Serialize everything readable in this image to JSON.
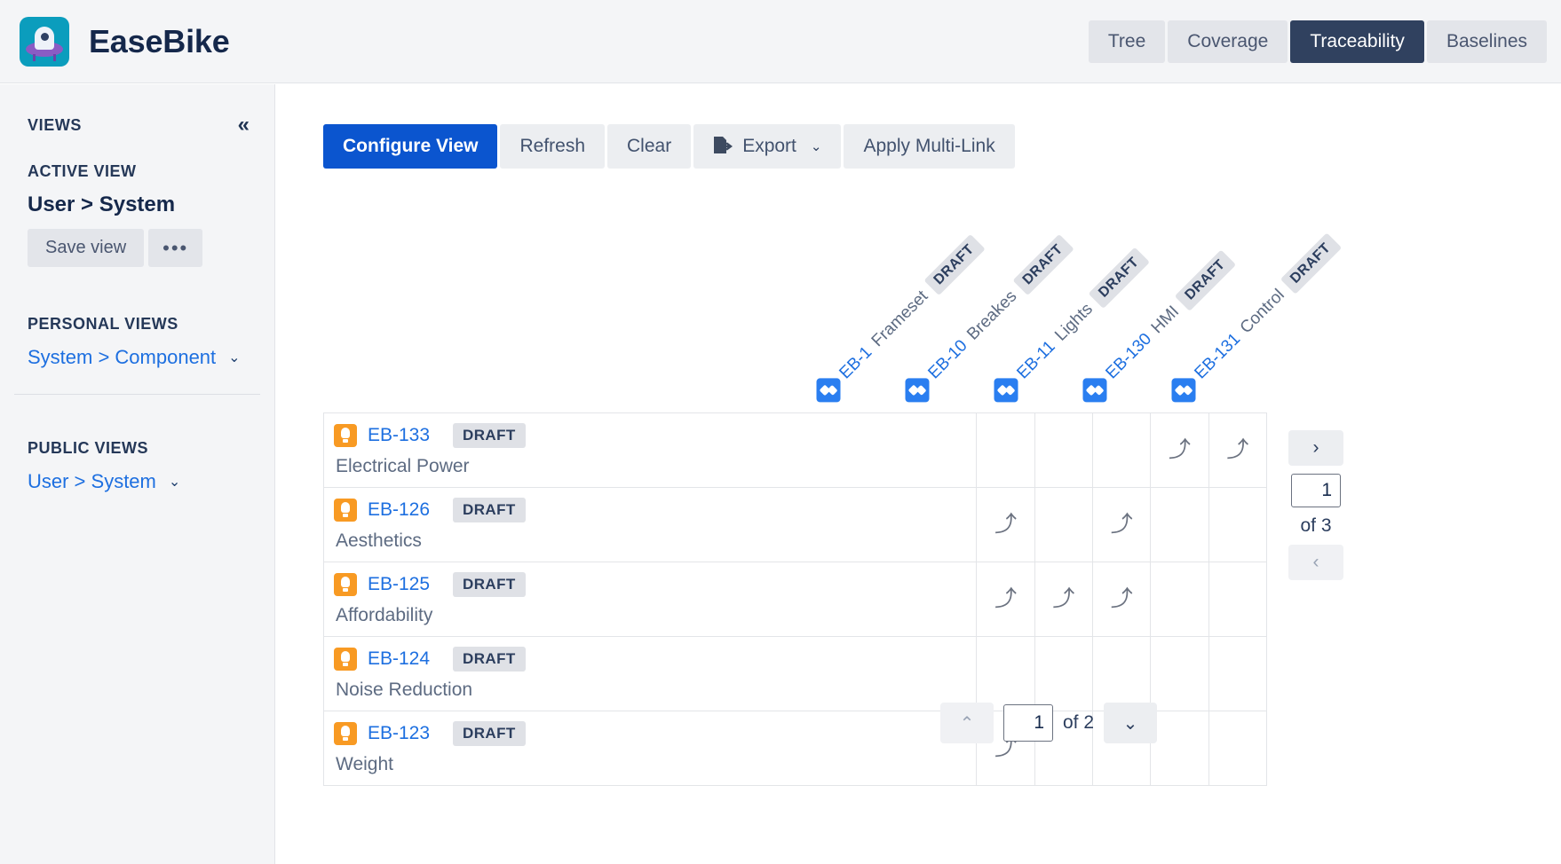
{
  "header": {
    "app_name": "EaseBike",
    "logo_icon": "easebike-alien-logo",
    "tabs": [
      {
        "label": "Tree",
        "active": false
      },
      {
        "label": "Coverage",
        "active": false
      },
      {
        "label": "Traceability",
        "active": true
      },
      {
        "label": "Baselines",
        "active": false
      }
    ]
  },
  "sidebar": {
    "title": "VIEWS",
    "collapse_icon": "«",
    "active_view_label": "ACTIVE VIEW",
    "active_view_name": "User > System",
    "save_view_label": "Save view",
    "more_label": "•••",
    "personal_views_label": "PERSONAL VIEWS",
    "personal_views": [
      {
        "label": "System > Component",
        "chevron": "⌄"
      }
    ],
    "public_views_label": "PUBLIC VIEWS",
    "public_views": [
      {
        "label": "User > System",
        "chevron": "⌄"
      }
    ]
  },
  "toolbar": {
    "configure_view": "Configure View",
    "refresh": "Refresh",
    "clear": "Clear",
    "export": "Export",
    "export_icon": "export-file-icon",
    "export_caret": "⌄",
    "apply_multi_link": "Apply Multi-Link"
  },
  "matrix": {
    "link_arrow_glyph": "⤴",
    "columns": [
      {
        "key": "EB-1",
        "summary": "Frameset",
        "status": "DRAFT",
        "icon": "jira-epic-diamond-icon"
      },
      {
        "key": "EB-10",
        "summary": "Breakes",
        "status": "DRAFT",
        "icon": "jira-epic-diamond-icon"
      },
      {
        "key": "EB-11",
        "summary": "Lights",
        "status": "DRAFT",
        "icon": "jira-epic-diamond-icon"
      },
      {
        "key": "EB-130",
        "summary": "HMI",
        "status": "DRAFT",
        "icon": "jira-epic-diamond-icon"
      },
      {
        "key": "EB-131",
        "summary": "Control",
        "status": "DRAFT",
        "icon": "jira-epic-diamond-icon"
      }
    ],
    "rows": [
      {
        "key": "EB-133",
        "status": "DRAFT",
        "summary": "Electrical Power",
        "icon": "lightbulb-icon",
        "links": [
          false,
          false,
          false,
          true,
          true
        ]
      },
      {
        "key": "EB-126",
        "status": "DRAFT",
        "summary": "Aesthetics",
        "icon": "lightbulb-icon",
        "links": [
          true,
          false,
          true,
          false,
          false
        ]
      },
      {
        "key": "EB-125",
        "status": "DRAFT",
        "summary": "Affordability",
        "icon": "lightbulb-icon",
        "links": [
          true,
          true,
          true,
          false,
          false
        ]
      },
      {
        "key": "EB-124",
        "status": "DRAFT",
        "summary": "Noise Reduction",
        "icon": "lightbulb-icon",
        "links": [
          false,
          false,
          false,
          false,
          false
        ]
      },
      {
        "key": "EB-123",
        "status": "DRAFT",
        "summary": "Weight",
        "icon": "lightbulb-icon",
        "links": [
          true,
          false,
          false,
          false,
          false
        ]
      }
    ]
  },
  "column_pager": {
    "next_icon": "›",
    "prev_icon": "‹",
    "page_value": "1",
    "of_label": "of 3"
  },
  "row_pager": {
    "up_icon": "⌃",
    "down_icon": "⌄",
    "page_value": "1",
    "of_label": "of 2"
  },
  "colors": {
    "primary": "#0b55cf",
    "tab_active_bg": "#30415f",
    "link": "#1d6fe0",
    "status_badge_bg": "#dfe1e6",
    "bulb_orange": "#f89a23",
    "diamond_blue": "#2a7ef0"
  }
}
